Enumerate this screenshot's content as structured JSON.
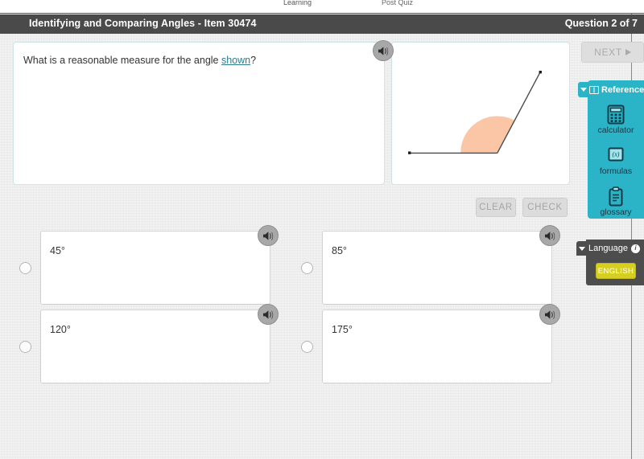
{
  "chrome": {
    "crumb_left": "",
    "crumb_learning": "Learning",
    "crumb_quiz": "Post Quiz",
    "crumb_right": ""
  },
  "titlebar": {
    "title": "Identifying and Comparing Angles - Item 30474",
    "progress": "Question 2 of 7"
  },
  "prompt": {
    "text_before": "What is a reasonable measure for the angle ",
    "link_text": "shown",
    "text_after": "?",
    "speaker_icon": "speaker-icon"
  },
  "diagram": {
    "type": "angle",
    "shaded_color": "#fbc6a5",
    "stroke_color": "#4a4a4a",
    "vertex": [
      132,
      139
    ],
    "ray1_end": [
      22,
      139
    ],
    "ray2_end": [
      186,
      37
    ],
    "arc_radius": 46
  },
  "actions": {
    "clear_label": "CLEAR",
    "check_label": "CHECK"
  },
  "options": [
    {
      "id": "a",
      "label": "45°",
      "selected": false,
      "speaker_icon": "speaker-icon"
    },
    {
      "id": "b",
      "label": "85°",
      "selected": false,
      "speaker_icon": "speaker-icon"
    },
    {
      "id": "c",
      "label": "120°",
      "selected": false,
      "speaker_icon": "speaker-icon"
    },
    {
      "id": "d",
      "label": "175°",
      "selected": false,
      "speaker_icon": "speaker-icon"
    }
  ],
  "rail": {
    "next_label": "NEXT",
    "reference": {
      "tab_label": "Reference",
      "tab_icon": "book-icon",
      "caret_icon": "caret-down-icon",
      "items": [
        {
          "label": "calculator",
          "icon": "calculator-icon"
        },
        {
          "label": "formulas",
          "icon": "formulas-icon"
        },
        {
          "label": "glossary",
          "icon": "clipboard-icon"
        }
      ]
    },
    "language": {
      "tab_label": "Language",
      "caret_icon": "caret-down-icon",
      "info_icon": "info-icon",
      "info_glyph": "i",
      "button_label": "ENGLISH"
    }
  },
  "colors": {
    "accent_teal": "#2bb3c8",
    "titlebar": "#4a4a4a",
    "page_bg": "#e9e9e9",
    "card_border": "#cfe3e9",
    "link": "#2f7c8c",
    "angle_fill": "#fbc6a5",
    "language_yellow": "#d6cf22"
  }
}
